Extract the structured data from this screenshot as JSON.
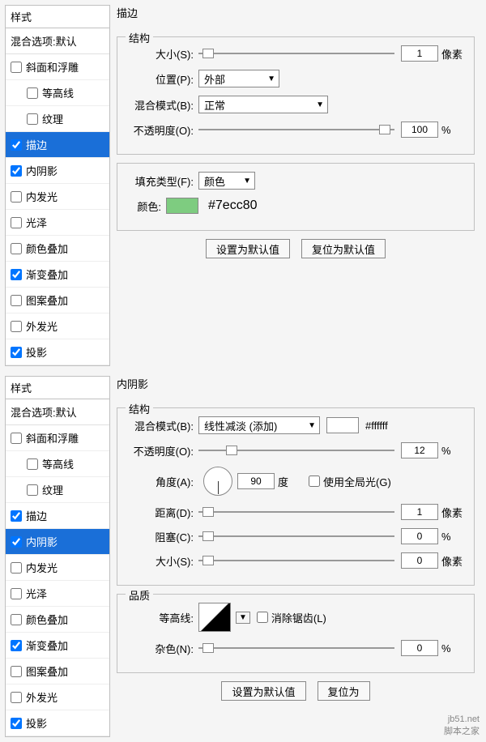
{
  "panels": [
    {
      "styleHeader": "样式",
      "blendOption": "混合选项:默认",
      "items": [
        {
          "label": "斜面和浮雕",
          "checked": false,
          "indent": false,
          "sel": false
        },
        {
          "label": "等高线",
          "checked": false,
          "indent": true,
          "sel": false
        },
        {
          "label": "纹理",
          "checked": false,
          "indent": true,
          "sel": false
        },
        {
          "label": "描边",
          "checked": true,
          "indent": false,
          "sel": true
        },
        {
          "label": "内阴影",
          "checked": true,
          "indent": false,
          "sel": false
        },
        {
          "label": "内发光",
          "checked": false,
          "indent": false,
          "sel": false
        },
        {
          "label": "光泽",
          "checked": false,
          "indent": false,
          "sel": false
        },
        {
          "label": "颜色叠加",
          "checked": false,
          "indent": false,
          "sel": false
        },
        {
          "label": "渐变叠加",
          "checked": true,
          "indent": false,
          "sel": false
        },
        {
          "label": "图案叠加",
          "checked": false,
          "indent": false,
          "sel": false
        },
        {
          "label": "外发光",
          "checked": false,
          "indent": false,
          "sel": false
        },
        {
          "label": "投影",
          "checked": true,
          "indent": false,
          "sel": false
        }
      ],
      "main": {
        "title": "描边",
        "structure": {
          "title": "结构",
          "size": {
            "label": "大小(S):",
            "value": "1",
            "unit": "像素",
            "thumb": 2
          },
          "position": {
            "label": "位置(P):",
            "value": "外部"
          },
          "blend": {
            "label": "混合模式(B):",
            "value": "正常"
          },
          "opacity": {
            "label": "不透明度(O):",
            "value": "100",
            "unit": "%",
            "thumb": 92
          }
        },
        "fill": {
          "typeLabel": "填充类型(F):",
          "typeValue": "颜色",
          "colorLabel": "颜色:",
          "colorHex": "#7ecc80",
          "swatch": "#7ecc80"
        },
        "buttons": {
          "default": "设置为默认值",
          "reset": "复位为默认值"
        }
      }
    },
    {
      "styleHeader": "样式",
      "blendOption": "混合选项:默认",
      "items": [
        {
          "label": "斜面和浮雕",
          "checked": false,
          "indent": false,
          "sel": false
        },
        {
          "label": "等高线",
          "checked": false,
          "indent": true,
          "sel": false
        },
        {
          "label": "纹理",
          "checked": false,
          "indent": true,
          "sel": false
        },
        {
          "label": "描边",
          "checked": true,
          "indent": false,
          "sel": false
        },
        {
          "label": "内阴影",
          "checked": true,
          "indent": false,
          "sel": true
        },
        {
          "label": "内发光",
          "checked": false,
          "indent": false,
          "sel": false
        },
        {
          "label": "光泽",
          "checked": false,
          "indent": false,
          "sel": false
        },
        {
          "label": "颜色叠加",
          "checked": false,
          "indent": false,
          "sel": false
        },
        {
          "label": "渐变叠加",
          "checked": true,
          "indent": false,
          "sel": false
        },
        {
          "label": "图案叠加",
          "checked": false,
          "indent": false,
          "sel": false
        },
        {
          "label": "外发光",
          "checked": false,
          "indent": false,
          "sel": false
        },
        {
          "label": "投影",
          "checked": true,
          "indent": false,
          "sel": false
        }
      ],
      "main": {
        "title": "内阴影",
        "structure": {
          "title": "结构",
          "blend": {
            "label": "混合模式(B):",
            "value": "线性减淡 (添加)",
            "swatch": "#ffffff",
            "hex": "#ffffff"
          },
          "opacity": {
            "label": "不透明度(O):",
            "value": "12",
            "unit": "%",
            "thumb": 14
          },
          "angle": {
            "label": "角度(A):",
            "value": "90",
            "unit": "度",
            "globalLabel": "使用全局光(G)",
            "globalChecked": false
          },
          "distance": {
            "label": "距离(D):",
            "value": "1",
            "unit": "像素",
            "thumb": 2
          },
          "choke": {
            "label": "阻塞(C):",
            "value": "0",
            "unit": "%",
            "thumb": 2
          },
          "size": {
            "label": "大小(S):",
            "value": "0",
            "unit": "像素",
            "thumb": 2
          }
        },
        "quality": {
          "title": "品质",
          "contourLabel": "等高线:",
          "antiAliasLabel": "消除锯齿(L)",
          "antiAliasChecked": false,
          "noise": {
            "label": "杂色(N):",
            "value": "0",
            "unit": "%",
            "thumb": 2
          }
        },
        "buttons": {
          "default": "设置为默认值",
          "reset": "复位为"
        }
      }
    }
  ],
  "watermark": {
    "line1": "jb51.net",
    "line2": "脚本之家"
  }
}
